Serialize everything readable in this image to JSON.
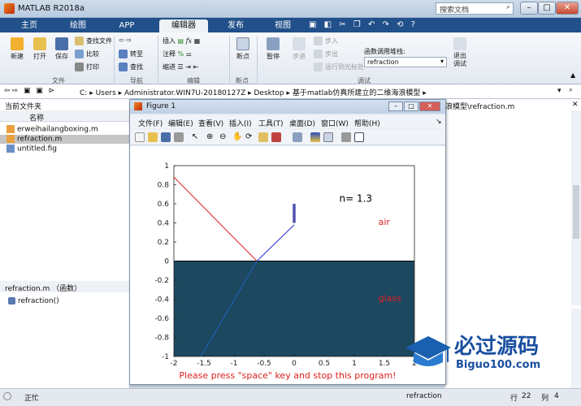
{
  "window": {
    "title": "MATLAB R2018a",
    "search_placeholder": "搜索文档",
    "min": "–",
    "max": "□",
    "close": "✕"
  },
  "tabs": [
    "主页",
    "绘图",
    "APP",
    "编辑器",
    "发布",
    "视图"
  ],
  "ribbon": {
    "new": "新建",
    "open": "打开",
    "save": "保存",
    "find_files": "查找文件",
    "compare": "比较",
    "print": "打印",
    "file_group": "文件",
    "goto": "转至",
    "find": "查找",
    "nav_group": "导航",
    "insert": "插入",
    "comment": "注释",
    "indent": "缩进",
    "edit_group": "编辑",
    "breakpoints": "断点",
    "bp_group": "断点",
    "pause": "暂停",
    "step": "步进",
    "step_in": "步入",
    "step_out": "步出",
    "run_to_cursor": "运行到光标处",
    "debug_group": "调试",
    "call_stack_label": "函数调用堆栈:",
    "call_stack_value": "refraction",
    "exit_debug": "退出调试"
  },
  "address": {
    "path": [
      "C:",
      "Users",
      "Administrator.WIN7U-20180127Z",
      "Desktop",
      "基于matlab仿真所建立的二维海浪模型"
    ]
  },
  "left_pane": {
    "header": "当前文件夹",
    "col_name": "名称",
    "files": [
      "erweihailangboxing.m",
      "refraction.m",
      "untitled.fig"
    ],
    "details_title": "refraction.m （函数）",
    "details_item": "refraction()"
  },
  "editor": {
    "tab_title": "浪模型\\refraction.m"
  },
  "status": {
    "state": "正忙",
    "file": "refraction",
    "row_label": "行",
    "row": "22",
    "col_label": "列",
    "col": "4"
  },
  "figure": {
    "title": "Figure 1",
    "menu": [
      "文件(F)",
      "编辑(E)",
      "查看(V)",
      "插入(I)",
      "工具(T)",
      "桌面(D)",
      "窗口(W)",
      "帮助(H)"
    ]
  },
  "chart_data": {
    "type": "line",
    "xlim": [
      -2,
      2
    ],
    "ylim": [
      -1,
      1
    ],
    "xticks": [
      "-2",
      "-1.5",
      "-1",
      "-0.5",
      "0",
      "0.5",
      "1",
      "1.5",
      "2"
    ],
    "yticks": [
      "1",
      "0.8",
      "0.6",
      "0.4",
      "0.2",
      "0",
      "-0.2",
      "-0.4",
      "-0.6",
      "-0.8",
      "-1"
    ],
    "annotations": {
      "n": "n= 1.3",
      "air": "air",
      "glass": "glass",
      "prompt": "Please press \"space\" key and stop this program!"
    },
    "lines": [
      {
        "color": "#e02020",
        "x": [
          -2,
          -0.62
        ],
        "y": [
          0.88,
          0
        ]
      },
      {
        "color": "#2030d0",
        "x": [
          -0.62,
          0
        ],
        "y": [
          0,
          0.38
        ]
      },
      {
        "color": "#2060c0",
        "x": [
          -0.62,
          -1.55
        ],
        "y": [
          0,
          -1
        ]
      }
    ],
    "glass_region": {
      "y_top": 0,
      "color": "#1c4860"
    },
    "marker": {
      "x": 0,
      "y": [
        0.4,
        0.6
      ],
      "color": "#5050b0"
    }
  },
  "watermark": {
    "text": "必过源码",
    "url": "Biguo100.com"
  }
}
